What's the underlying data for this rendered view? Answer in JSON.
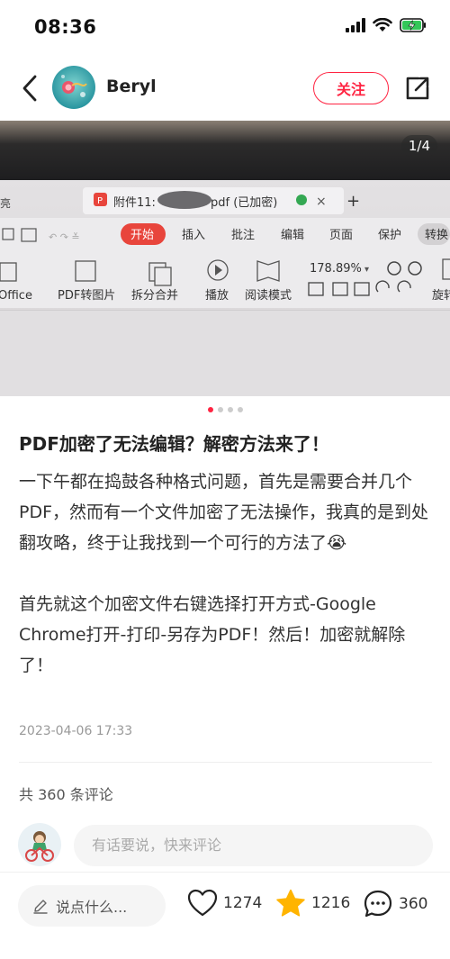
{
  "status_bar": {
    "time": "08:36"
  },
  "author": {
    "name": "Beryl",
    "follow_label": "关注"
  },
  "gallery": {
    "page_indicator": "1/4",
    "screen_texts": {
      "tab": "附件11:",
      "tab_suffix": "pdf (已加密)",
      "side": "亮",
      "menu": [
        "开始",
        "插入",
        "批注",
        "编辑",
        "页面",
        "保护",
        "转换"
      ],
      "tools": [
        "Office",
        "PDF转图片",
        "拆分合并",
        "播放",
        "阅读模式",
        "旋转"
      ],
      "zoom": "178.89%"
    }
  },
  "post": {
    "title": "PDF加密了无法编辑？解密方法来了！",
    "paragraph1": "一下午都在捣鼓各种格式问题，首先是需要合并几个PDF，然而有一个文件加密了无法操作，我真的是到处翻攻略，终于让我找到一个可行的方法了😭",
    "paragraph2": "首先就这个加密文件右键选择打开方式-Google Chrome打开-打印-另存为PDF！然后！加密就解除了！",
    "date": "2023-04-06 17:33"
  },
  "comments": {
    "count_text": "共 360 条评论",
    "input_placeholder": "有话要说，快来评论"
  },
  "bottom_bar": {
    "say_label": "说点什么...",
    "likes": "1274",
    "collects": "1216",
    "comments": "360"
  },
  "colors": {
    "accent": "#ff2442",
    "star": "#ffb400"
  }
}
